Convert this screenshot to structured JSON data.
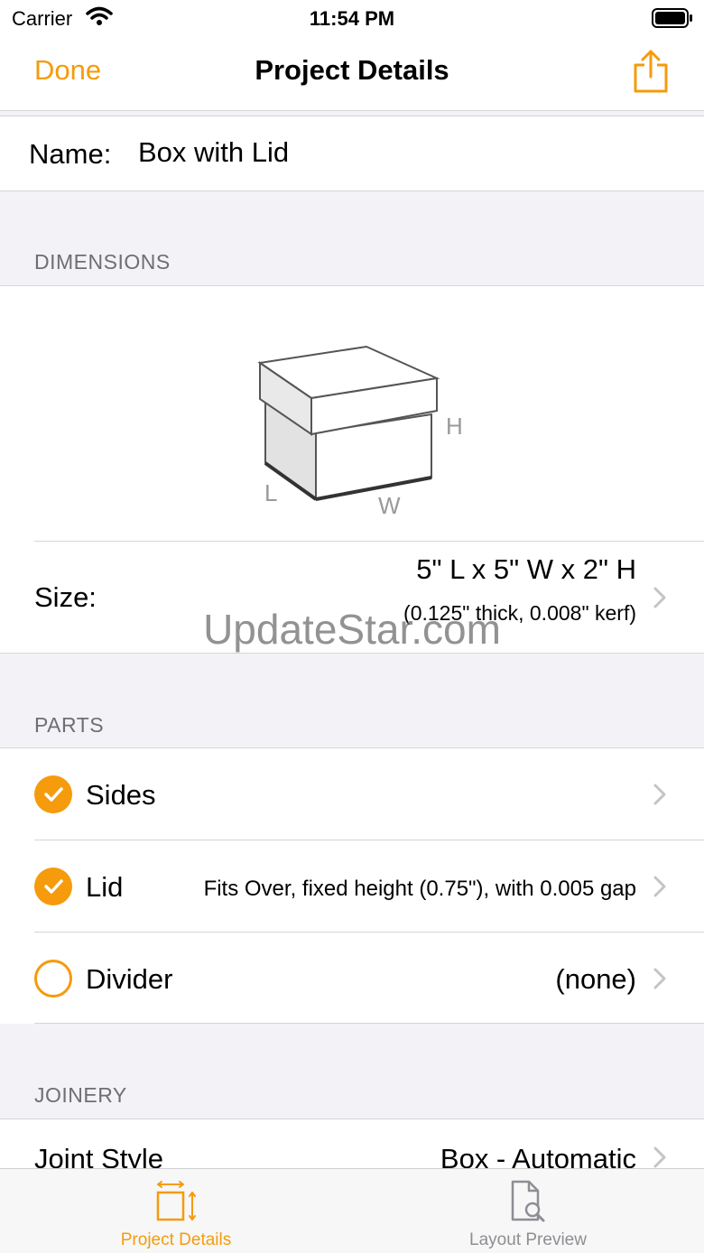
{
  "status_bar": {
    "carrier": "Carrier",
    "time": "11:54 PM"
  },
  "nav": {
    "done_label": "Done",
    "title": "Project Details",
    "share_icon": "share-icon"
  },
  "name_row": {
    "label": "Name:",
    "value": "Box with Lid"
  },
  "dimensions": {
    "header": "DIMENSIONS",
    "diagram_labels": {
      "h": "H",
      "l": "L",
      "w": "W"
    },
    "size_label": "Size:",
    "size_value": "5\" L x 5\" W x 2\" H",
    "size_detail": "(0.125\" thick, 0.008\" kerf)"
  },
  "parts": {
    "header": "PARTS",
    "items": [
      {
        "label": "Sides",
        "detail": "",
        "checked": true
      },
      {
        "label": "Lid",
        "detail": "Fits Over, fixed height (0.75\"), with 0.005 gap",
        "checked": true
      },
      {
        "label": "Divider",
        "detail": "(none)",
        "checked": false
      }
    ]
  },
  "joinery": {
    "header": "JOINERY",
    "joint_style_label": "Joint Style",
    "joint_style_value": "Box - Automatic"
  },
  "watermark": "UpdateStar.com",
  "tabs": [
    {
      "label": "Project Details",
      "icon": "dimensions-icon",
      "active": true
    },
    {
      "label": "Layout Preview",
      "icon": "document-search-icon",
      "active": false
    }
  ],
  "colors": {
    "accent": "#f59b0c",
    "secondary_text": "#6e6e73",
    "separator": "#d6d6d6",
    "group_background": "#f2f2f7"
  }
}
